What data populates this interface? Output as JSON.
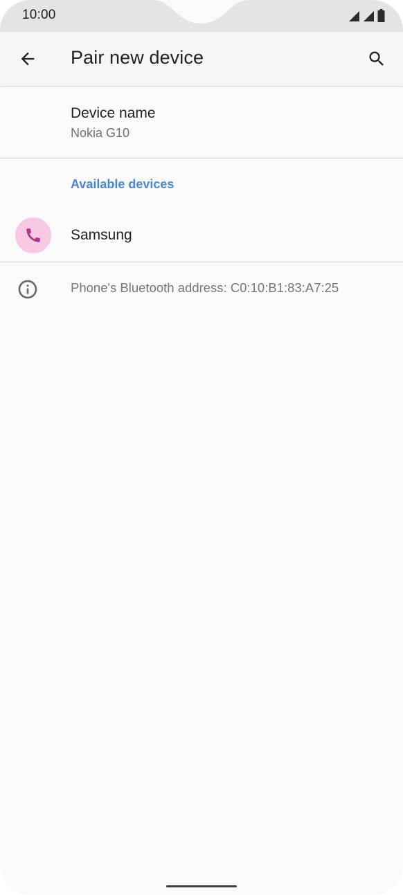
{
  "status_bar": {
    "time": "10:00",
    "icons": [
      "signal-icon",
      "signal-icon",
      "battery-icon"
    ]
  },
  "app_bar": {
    "title": "Pair new device",
    "back_icon": "arrow-back-icon",
    "search_icon": "search-icon"
  },
  "device_name": {
    "title": "Device name",
    "value": "Nokia G10"
  },
  "available_devices": {
    "header": "Available devices",
    "items": [
      {
        "label": "Samsung",
        "icon": "phone-icon",
        "icon_color": "#b03a87",
        "icon_bg": "#f8c9e3"
      }
    ]
  },
  "info": {
    "icon": "info-icon",
    "text": "Phone's Bluetooth address: C0:10:B1:83:A7:25"
  },
  "colors": {
    "accent": "#4a86d2",
    "background": "#fafafa",
    "status_bar": "#e4e4e4"
  }
}
